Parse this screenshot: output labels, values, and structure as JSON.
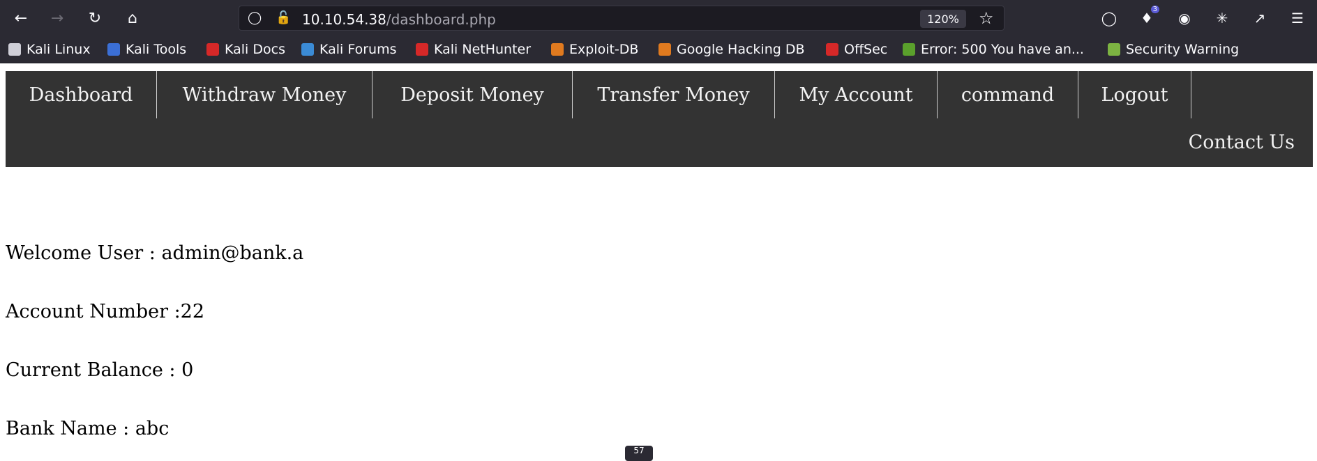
{
  "browser": {
    "url_host": "10.10.54.38",
    "url_path": "/dashboard.php",
    "zoom": "120%",
    "extension_badge": "3",
    "icons": {
      "back": "arrow-left-icon",
      "forward": "arrow-right-icon",
      "reload": "reload-icon",
      "home": "home-icon",
      "shield": "shield-icon",
      "insecure": "lock-strike-icon",
      "bookmark_star": "star-icon",
      "pocket": "pocket-icon",
      "extension": "extension-icon",
      "blocker": "blocker-icon",
      "puzzle": "puzzle-icon",
      "share": "share-icon",
      "menu": "hamburger-icon"
    }
  },
  "bookmarks": [
    {
      "label": "Kali Linux",
      "color": "#cfcfd8"
    },
    {
      "label": "Kali Tools",
      "color": "#3b6fd6"
    },
    {
      "label": "Kali Docs",
      "color": "#d62828"
    },
    {
      "label": "Kali Forums",
      "color": "#3b8bd6"
    },
    {
      "label": "Kali NetHunter",
      "color": "#d62828"
    },
    {
      "label": "Exploit-DB",
      "color": "#e07a1f"
    },
    {
      "label": "Google Hacking DB",
      "color": "#e07a1f"
    },
    {
      "label": "OffSec",
      "color": "#d62828"
    },
    {
      "label": "Error: 500 You have an...",
      "color": "#5aa02c"
    },
    {
      "label": "Security Warning",
      "color": "#7cb342"
    }
  ],
  "nav": {
    "items": [
      {
        "label": "Dashboard"
      },
      {
        "label": "Withdraw Money"
      },
      {
        "label": "Deposit Money"
      },
      {
        "label": "Transfer Money"
      },
      {
        "label": "My Account"
      },
      {
        "label": "command"
      },
      {
        "label": "Logout"
      }
    ],
    "contact": "Contact Us"
  },
  "info": {
    "welcome": "Welcome User : admin@bank.a",
    "account": "Account Number :22",
    "balance": "Current Balance : 0",
    "bank": "Bank Name : abc"
  },
  "tooltip": "57",
  "colors": {
    "chrome": "#2b2a33",
    "navbar": "#333333",
    "nav_text": "#f2f2f2"
  }
}
